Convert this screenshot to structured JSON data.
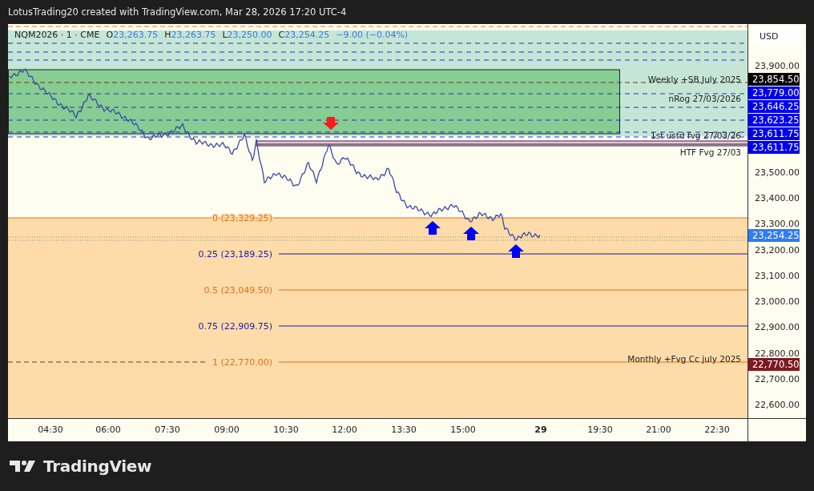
{
  "attribution": "LotusTrading20 created with TradingView.com, Mar 28, 2026 17:20 UTC-4",
  "legend": {
    "symbol": "NQM2026 · 1 · CME",
    "values": [
      {
        "label": "O",
        "value": "23,263.75"
      },
      {
        "label": "H",
        "value": "23,263.75"
      },
      {
        "label": "L",
        "value": "23,250.00"
      },
      {
        "label": "C",
        "value": "23,254.25"
      }
    ],
    "change": "−9.00 (−0.04%)"
  },
  "currency_button": "USD",
  "annotations": [
    {
      "text": "Weekly +SB July 2025"
    },
    {
      "text": "nRog 27/03/2026"
    },
    {
      "text": "1st ustd fvg 27/03/26"
    },
    {
      "text": "HTF Fvg 27/03"
    },
    {
      "text": "Monthly  +Fvg Cc  july 2025"
    }
  ],
  "fib_levels": [
    {
      "label": "0 (23,329.25)",
      "color": "#e0701c"
    },
    {
      "label": "0.25 (23,189.25)",
      "color": "#1a1aa8"
    },
    {
      "label": "0.5 (23,049.50)",
      "color": "#e0701c"
    },
    {
      "label": "0.75 (22,909.75)",
      "color": "#1a1aa8"
    },
    {
      "label": "1 (22,770.00)",
      "color": "#e0701c"
    }
  ],
  "markers": [
    {
      "kind": "sell"
    },
    {
      "kind": "buy"
    },
    {
      "kind": "buy"
    },
    {
      "kind": "buy"
    }
  ],
  "price_axis": {
    "ticks": [
      "23,900.00",
      "23,500.00",
      "23,400.00",
      "23,300.00",
      "23,200.00",
      "23,100.00",
      "23,000.00",
      "22,900.00",
      "22,800.00",
      "22,700.00",
      "22,600.00"
    ],
    "badges": [
      {
        "price": "23,854.50",
        "color": "#000000"
      },
      {
        "price": "23,779.00",
        "color": "#0000ee"
      },
      {
        "price": "23,646.25",
        "color": "#0000ee"
      },
      {
        "price": "23,623.25",
        "color": "#0000ee"
      },
      {
        "price": "23,611.75",
        "color": "#0000ee"
      },
      {
        "price": "23,611.75",
        "color": "#0000ee"
      },
      {
        "price": "23,254.25",
        "color": "#2e7cf6"
      },
      {
        "price": "22,770.50",
        "color": "#7a1a22"
      }
    ]
  },
  "time_axis": [
    {
      "label": "04:30",
      "kind": "time"
    },
    {
      "label": "06:00",
      "kind": "time"
    },
    {
      "label": "07:30",
      "kind": "time"
    },
    {
      "label": "09:00",
      "kind": "time"
    },
    {
      "label": "10:30",
      "kind": "time"
    },
    {
      "label": "12:00",
      "kind": "time"
    },
    {
      "label": "13:30",
      "kind": "time"
    },
    {
      "label": "15:00",
      "kind": "time"
    },
    {
      "label": "29",
      "kind": "day"
    },
    {
      "label": "19:30",
      "kind": "time"
    },
    {
      "label": "21:00",
      "kind": "time"
    },
    {
      "label": "22:30",
      "kind": "time"
    }
  ],
  "brand": "TradingView"
}
